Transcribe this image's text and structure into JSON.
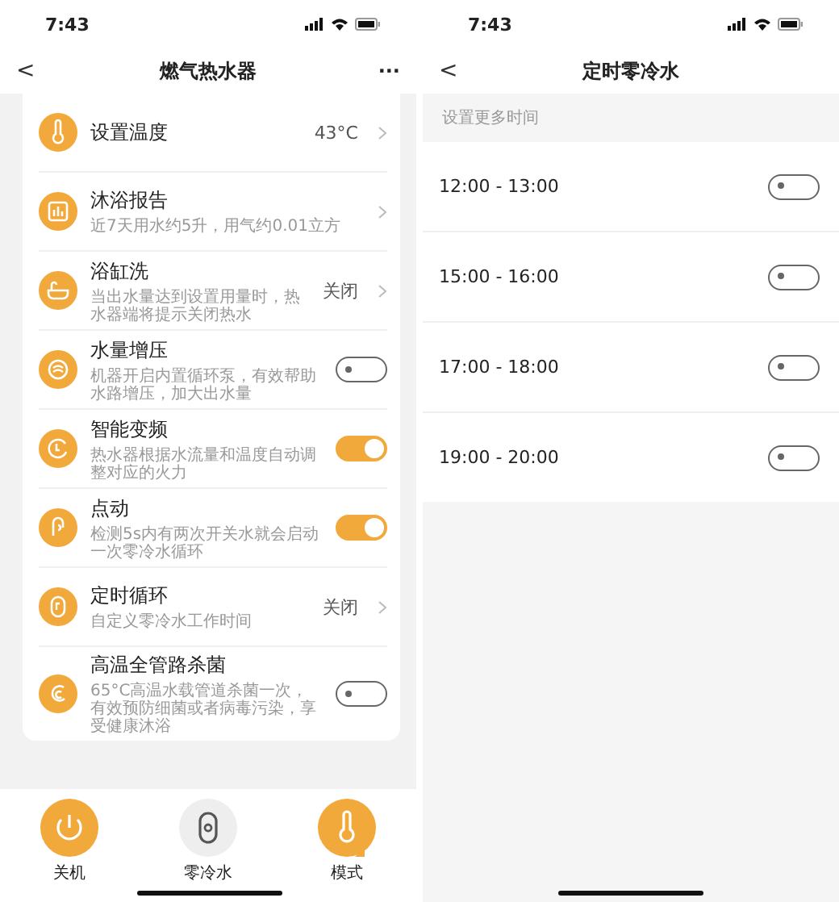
{
  "left_screen": {
    "status_bar": {
      "time": "7:43"
    },
    "nav": {
      "back": "<",
      "title": "燃气热水器",
      "more": "···"
    },
    "rows": [
      {
        "kind": "link",
        "title": "设置温度",
        "value": "43°C"
      },
      {
        "kind": "link",
        "title": "沐浴报告",
        "subtitle": "近7天用水约5升，用气约0.01立方"
      },
      {
        "kind": "link",
        "title": "浴缸洗",
        "subtitle": "当出水量达到设置用量时，热水器端将提示关闭热水",
        "value": "关闭"
      },
      {
        "kind": "toggle",
        "title": "水量增压",
        "subtitle": "机器开启内置循环泵，有效帮助水路增压，加大出水量",
        "on": false
      },
      {
        "kind": "toggle",
        "title": "智能变频",
        "subtitle": "热水器根据水流量和温度自动调整对应的火力",
        "on": true
      },
      {
        "kind": "toggle",
        "title": "点动",
        "subtitle": "检测5s内有两次开关水就会启动一次零冷水循环",
        "on": true
      },
      {
        "kind": "link",
        "title": "定时循环",
        "subtitle": "自定义零冷水工作时间",
        "value": "关闭"
      },
      {
        "kind": "toggle",
        "title": "高温全管路杀菌",
        "subtitle": "65°C高温水载管道杀菌一次，有效预防细菌或者病毒污染，享受健康沐浴",
        "on": false
      }
    ],
    "bottom_bar": [
      {
        "label": "关机",
        "active": true
      },
      {
        "label": "零冷水",
        "active": false
      },
      {
        "label": "模式",
        "active": true
      }
    ]
  },
  "right_screen": {
    "status_bar": {
      "time": "7:43"
    },
    "nav": {
      "back": "<",
      "title": "定时零冷水"
    },
    "section_header": "设置更多时间",
    "slots": [
      {
        "label": "12:00 - 13:00",
        "on": false
      },
      {
        "label": "15:00 - 16:00",
        "on": false
      },
      {
        "label": "17:00 - 18:00",
        "on": false
      },
      {
        "label": "19:00 - 20:00",
        "on": false
      }
    ]
  }
}
